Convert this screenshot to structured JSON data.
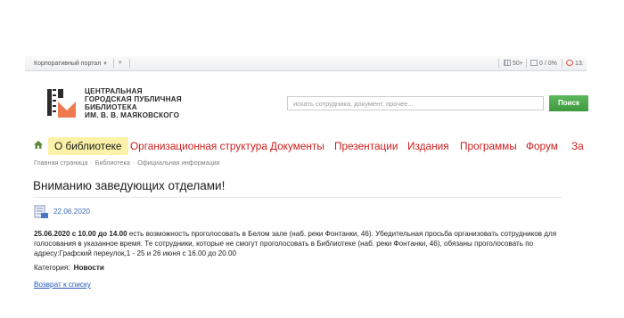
{
  "topbar": {
    "portal": "Корпоративный портал",
    "portal_arrow": "▾",
    "mini": "▾",
    "stat_users": "50+",
    "stat_progress": "0 / 0%",
    "stat_time": "13:"
  },
  "logo": {
    "line1": "ЦЕНТРАЛЬНАЯ",
    "line2": "ГОРОДСКАЯ ПУБЛИЧНАЯ",
    "line3": "БИБЛИОТЕКА",
    "line4": "ИМ. В. В. МАЯКОВСКОГО"
  },
  "search": {
    "placeholder": "искать сотрудника, документ, прочее...",
    "button": "Поиск"
  },
  "nav": {
    "home_icon": "home-icon",
    "items": [
      {
        "label": "О библиотеке",
        "active": true
      },
      {
        "label": "Организационная структура"
      },
      {
        "label": "Документы"
      },
      {
        "label": "Презентации"
      },
      {
        "label": "Издания"
      },
      {
        "label": "Программы"
      },
      {
        "label": "Форум"
      },
      {
        "label": "За"
      }
    ]
  },
  "breadcrumb": [
    "Главная страница",
    "Библиотека",
    "Официальная информация"
  ],
  "article": {
    "title": "Вниманию заведующих отделами!",
    "date": "22.06.2020",
    "lead_bold": "25.06.2020 с 10.00 до 14.00",
    "body": " есть возможность проголосовать в Белом зале (наб. реки Фонтанки, 46). Убедительная просьба организовать сотрудников для голосования в указанное время. Те сотрудники, которые не смогут проголосовать в Библиотеке (наб. реки Фонтанки, 46), обязаны проголосовать по адресу:Графский переулок,1 - 25 и 26 июня с 16.00 до 20.00",
    "category_label": "Категория:",
    "category_value": "Новости",
    "back_link": "Возврат к списку"
  },
  "colors": {
    "nav_red": "#cc1d1d",
    "nav_active_bg": "#fbf1a8",
    "search_green": "#4cae4c",
    "link_blue": "#2459b8",
    "logo_orange": "#f07a50"
  }
}
